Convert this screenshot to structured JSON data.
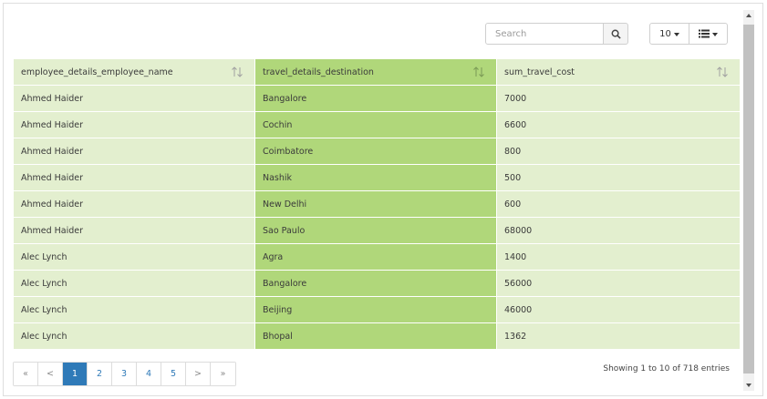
{
  "search": {
    "placeholder": "Search"
  },
  "toolbar": {
    "page_size": "10",
    "page_size_icon": "caret-down-icon",
    "columns_icon": "list-icon"
  },
  "table": {
    "columns": [
      {
        "label": "employee_details_employee_name",
        "color": "#e3efcf"
      },
      {
        "label": "travel_details_destination",
        "color": "#b0d77a"
      },
      {
        "label": "sum_travel_cost",
        "color": "#e3efcf"
      }
    ],
    "rows": [
      [
        "Ahmed Haider",
        "Bangalore",
        "7000"
      ],
      [
        "Ahmed Haider",
        "Cochin",
        "6600"
      ],
      [
        "Ahmed Haider",
        "Coimbatore",
        "800"
      ],
      [
        "Ahmed Haider",
        "Nashik",
        "500"
      ],
      [
        "Ahmed Haider",
        "New Delhi",
        "600"
      ],
      [
        "Ahmed Haider",
        "Sao Paulo",
        "68000"
      ],
      [
        "Alec Lynch",
        "Agra",
        "1400"
      ],
      [
        "Alec Lynch",
        "Bangalore",
        "56000"
      ],
      [
        "Alec Lynch",
        "Beijing",
        "46000"
      ],
      [
        "Alec Lynch",
        "Bhopal",
        "1362"
      ]
    ]
  },
  "pagination": {
    "first": "«",
    "prev": "<",
    "pages": [
      "1",
      "2",
      "3",
      "4",
      "5"
    ],
    "active": "1",
    "next": ">",
    "last": "»"
  },
  "info": "Showing 1 to 10 of 718 entries",
  "colors": {
    "accent": "#2f7ab8",
    "highlight_column": "#b0d77a",
    "column": "#e3efcf"
  }
}
